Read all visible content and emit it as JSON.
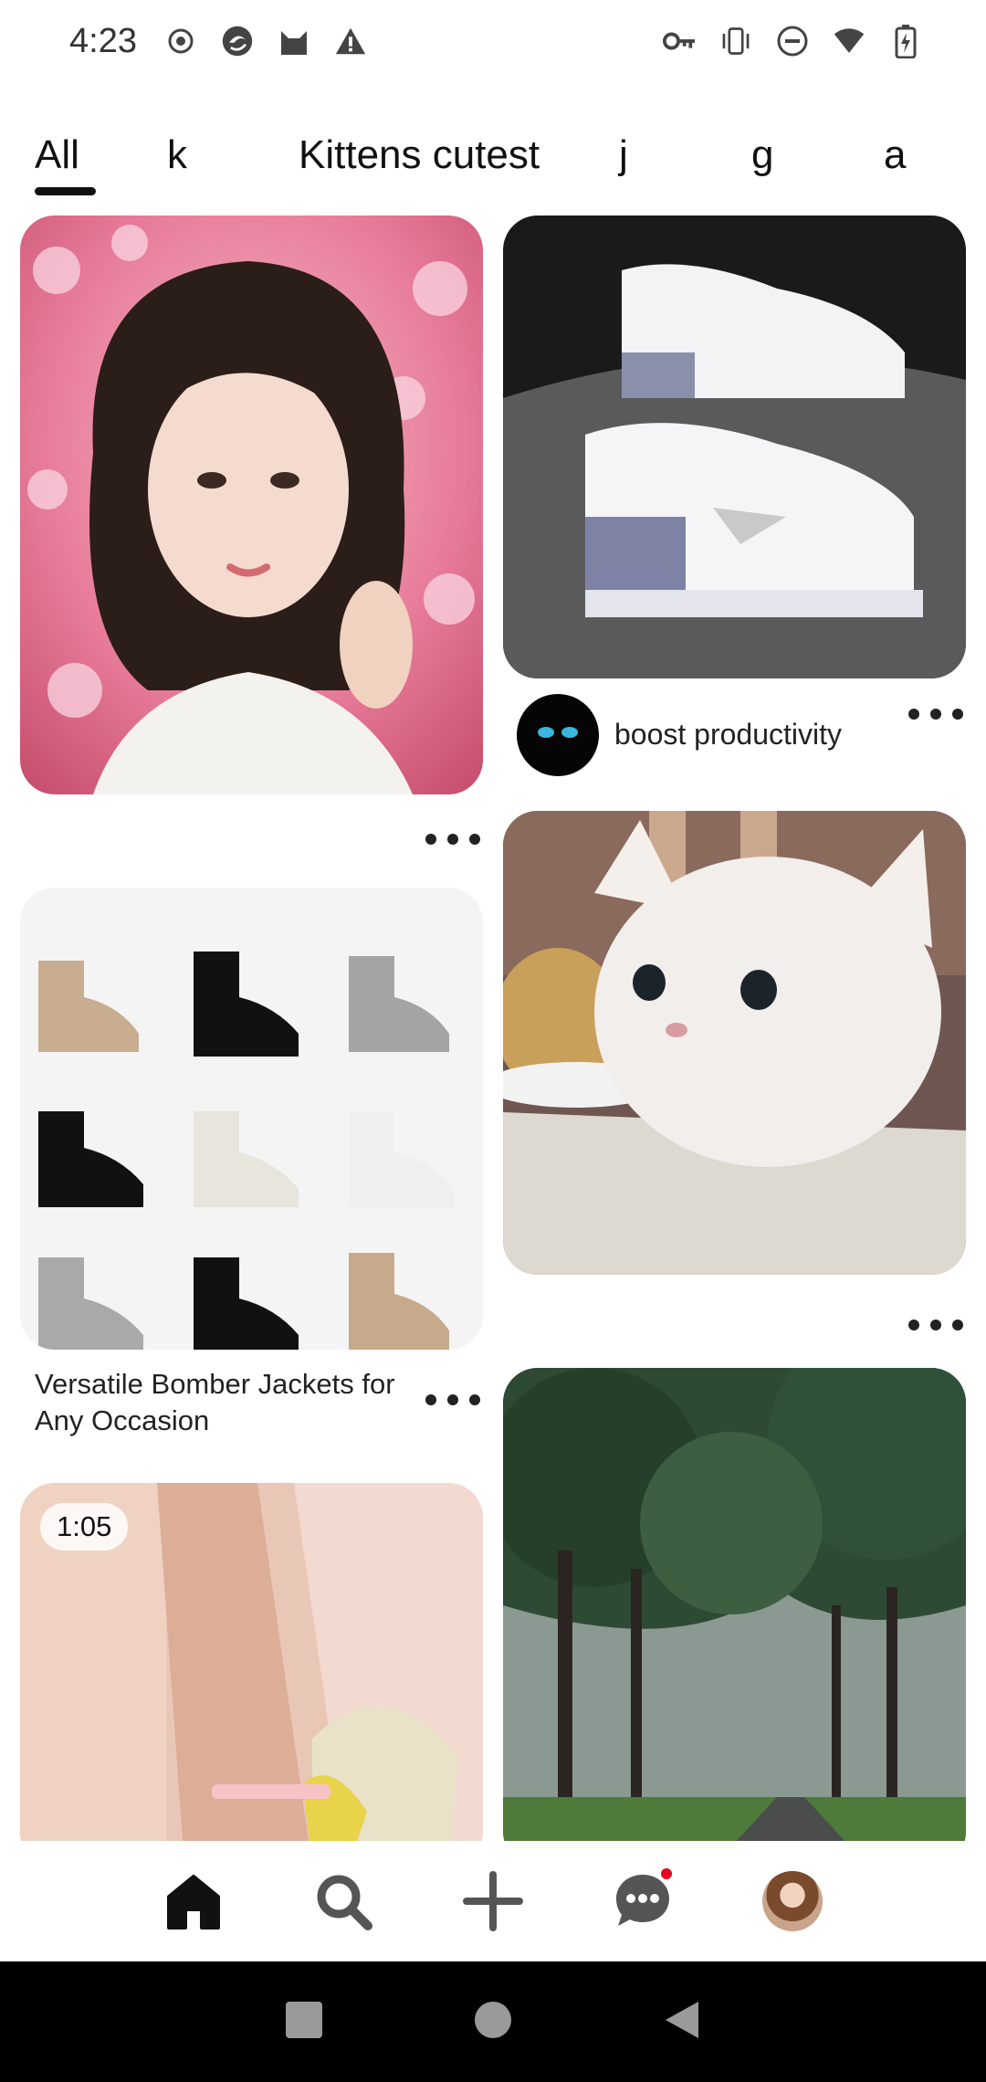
{
  "status_bar": {
    "time": "4:23",
    "left_icons": [
      "record-icon",
      "browser-icon",
      "cat-app-icon",
      "warning-icon"
    ],
    "right_icons": [
      "vpn-key-icon",
      "vibrate-icon",
      "dnd-icon",
      "wifi-icon",
      "battery-icon"
    ]
  },
  "tabs": [
    {
      "label": "All",
      "selected": true
    },
    {
      "label": "k"
    },
    {
      "label": "Kittens cutest"
    },
    {
      "label": "j"
    },
    {
      "label": "g"
    },
    {
      "label": "a"
    }
  ],
  "feed": {
    "pins": [
      {
        "image": "Woman with cherry blossoms"
      },
      {
        "image": "White sneakers",
        "board_name": "boost productivity"
      },
      {
        "image": "White kitten with pastry"
      },
      {
        "image": "Chelsea boots grid",
        "title": "Versatile Bomber Jackets for Any Occasion"
      },
      {
        "image": "Forest road in rain"
      },
      {
        "image": "Close-up of legs video",
        "duration": "1:05"
      }
    ]
  },
  "bottom_nav": {
    "items": [
      "home-icon",
      "search-icon",
      "create-icon",
      "messages-icon",
      "profile-avatar"
    ],
    "messages_has_notification": true
  },
  "colors": {
    "accent": "#e60023",
    "text": "#111111"
  }
}
